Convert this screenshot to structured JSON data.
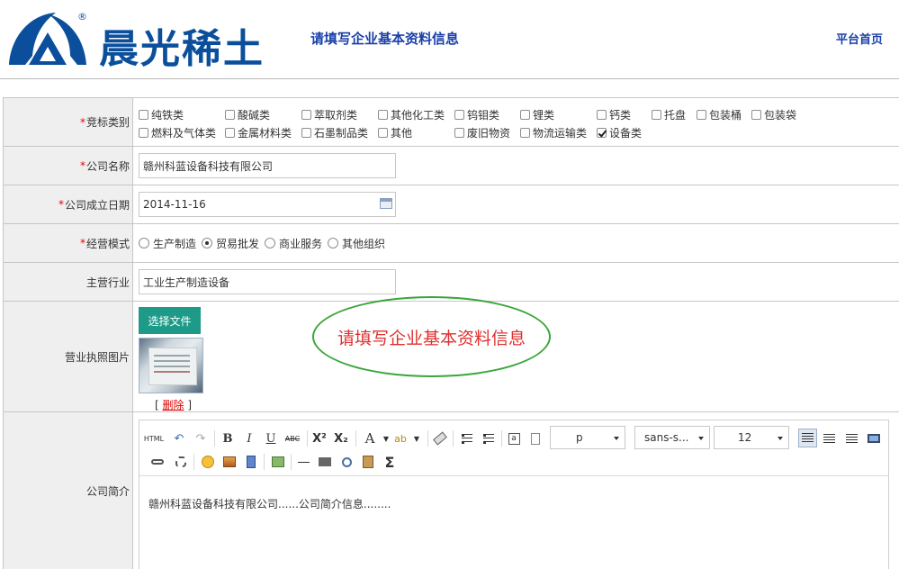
{
  "header": {
    "brand": "晨光稀土",
    "reg_mark": "®",
    "title": "请填写企业基本资料信息",
    "home_link": "平台首页"
  },
  "colors": {
    "brand_blue": "#0b4f9c",
    "title_blue": "#1a3fa8",
    "required_red": "#ee0000",
    "button_teal": "#1e9b88",
    "oval_green": "#3aa53a",
    "tip_red": "#e03030"
  },
  "form": {
    "required_mark": "*",
    "category": {
      "label": "竞标类别",
      "options": [
        {
          "label": "纯铁类",
          "checked": false
        },
        {
          "label": "酸碱类",
          "checked": false
        },
        {
          "label": "萃取剂类",
          "checked": false
        },
        {
          "label": "其他化工类",
          "checked": false
        },
        {
          "label": "钨钼类",
          "checked": false
        },
        {
          "label": "锂类",
          "checked": false
        },
        {
          "label": "钙类",
          "checked": false
        },
        {
          "label": "托盘",
          "checked": false
        },
        {
          "label": "包装桶",
          "checked": false
        },
        {
          "label": "包装袋",
          "checked": false
        },
        {
          "label": "燃料及气体类",
          "checked": false
        },
        {
          "label": "金属材料类",
          "checked": false
        },
        {
          "label": "石墨制品类",
          "checked": false
        },
        {
          "label": "其他",
          "checked": false
        },
        {
          "label": "废旧物资",
          "checked": false
        },
        {
          "label": "物流运输类",
          "checked": false
        },
        {
          "label": "设备类",
          "checked": true
        }
      ]
    },
    "company_name": {
      "label": "公司名称",
      "value": "赣州科蓝设备科技有限公司"
    },
    "founded_date": {
      "label": "公司成立日期",
      "value": "2014-11-16"
    },
    "business_mode": {
      "label": "经营模式",
      "options": [
        {
          "label": "生产制造",
          "selected": false
        },
        {
          "label": "贸易批发",
          "selected": true
        },
        {
          "label": "商业服务",
          "selected": false
        },
        {
          "label": "其他组织",
          "selected": false
        }
      ]
    },
    "industry": {
      "label": "主营行业",
      "value": "工业生产制造设备"
    },
    "license_image": {
      "label": "营业执照图片",
      "select_button": "选择文件",
      "delete_open": "[",
      "delete_link": "删除",
      "delete_close": "]",
      "tip": "请填写企业基本资料信息"
    },
    "intro": {
      "label": "公司简介",
      "content": "赣州科蓝设备科技有限公司......公司简介信息........",
      "toolbar": {
        "html_btn": "HTML",
        "bold": "B",
        "italic": "I",
        "underline": "U",
        "strike": "ABC",
        "superscript": "X²",
        "subscript": "X₂",
        "font_color": "A",
        "highlight": "ab",
        "paragraph_select": "p",
        "font_family_select": "sans-s...",
        "font_size_select": "12",
        "formula": "Σ"
      }
    }
  }
}
